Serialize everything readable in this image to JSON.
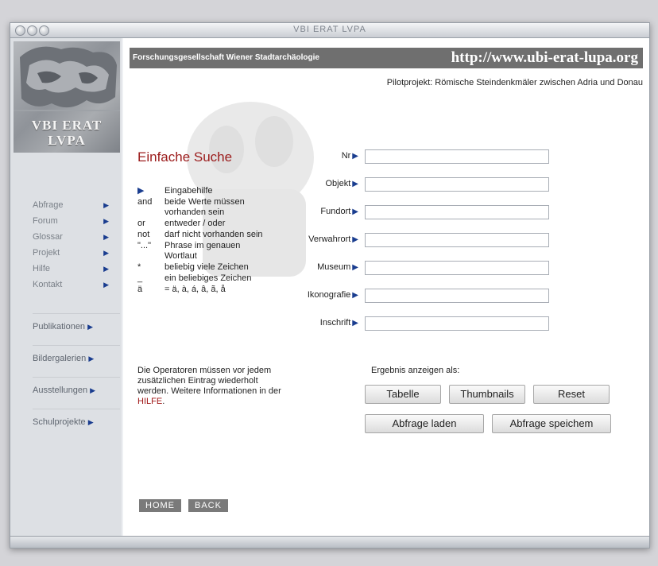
{
  "window": {
    "title": "VBI ERAT LVPA"
  },
  "logo": {
    "line1": "VBI ERAT",
    "line2": "LVPA"
  },
  "sidebar": {
    "items": [
      {
        "label": "Abfrage"
      },
      {
        "label": "Forum"
      },
      {
        "label": "Glossar"
      },
      {
        "label": "Projekt"
      },
      {
        "label": "Hilfe"
      },
      {
        "label": "Kontakt"
      }
    ],
    "sections": [
      {
        "label": "Publikationen"
      },
      {
        "label": "Bildergalerien"
      },
      {
        "label": "Ausstellungen"
      },
      {
        "label": "Schulprojekte"
      }
    ],
    "arrow": "▶"
  },
  "header": {
    "org": "Forschungsgesellschaft Wiener Stadtarchäologie",
    "url": "http://www.ubi-erat-lupa.org",
    "subtitle": "Pilotprojekt: Römische Steindenkmäler zwischen Adria und Donau"
  },
  "search": {
    "title": "Einfache Suche",
    "help": [
      {
        "op": "▶",
        "text": "Eingabehilfe"
      },
      {
        "op": "and",
        "text": "beide Werte müssen vorhanden sein"
      },
      {
        "op": "or",
        "text": "entweder / oder"
      },
      {
        "op": "not",
        "text": "darf nicht vorhanden sein"
      },
      {
        "op": "\"...\"",
        "text": "Phrase im genauen Wortlaut"
      },
      {
        "op": "*",
        "text": "beliebig viele Zeichen"
      },
      {
        "op": "_",
        "text": "ein beliebiges Zeichen"
      },
      {
        "op": "ä",
        "text": "= ä, à, á, â, ã, å"
      }
    ],
    "note": "Die Operatoren müssen vor jedem zusätzlichen Eintrag wiederholt werden. Weitere Informationen in der ",
    "note_link": "HILFE",
    "note_end": ".",
    "fields": [
      {
        "label": "Nr",
        "value": ""
      },
      {
        "label": "Objekt",
        "value": ""
      },
      {
        "label": "Fundort",
        "value": ""
      },
      {
        "label": "Verwahrort",
        "value": ""
      },
      {
        "label": "Museum",
        "value": ""
      },
      {
        "label": "Ikonografie",
        "value": ""
      },
      {
        "label": "Inschrift",
        "value": ""
      }
    ],
    "field_arrow": "▶",
    "result_label": "Ergebnis anzeigen als:",
    "buttons": {
      "table": "Tabelle",
      "thumbnails": "Thumbnails",
      "reset": "Reset",
      "load": "Abfrage laden",
      "save": "Abfrage speichem"
    }
  },
  "footer_nav": {
    "home": "HOME",
    "back": "BACK"
  }
}
